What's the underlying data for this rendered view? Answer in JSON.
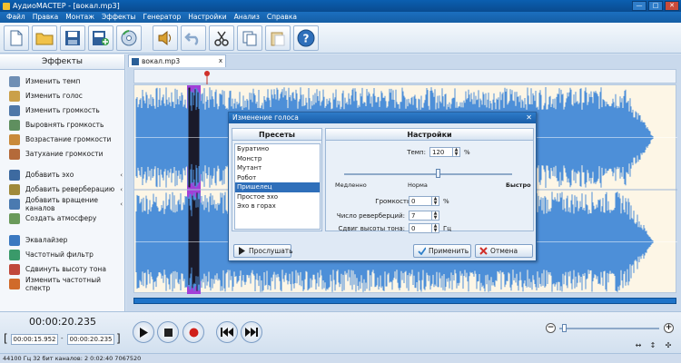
{
  "window": {
    "title": "АудиоМАСТЕР - [вокал.mp3]",
    "controls": [
      "—",
      "□",
      "✕"
    ]
  },
  "menu": [
    "Файл",
    "Правка",
    "Монтаж",
    "Эффекты",
    "Генератор",
    "Настройки",
    "Анализ",
    "Справка"
  ],
  "toolbar": {
    "buttons": [
      "new-file",
      "open-folder",
      "save",
      "add-file",
      "record-cd",
      "speaker",
      "undo",
      "cut",
      "copy",
      "paste",
      "help"
    ]
  },
  "effects": {
    "header": "Эффекты",
    "items": [
      {
        "label": "Изменить темп",
        "icon": "clock-icon",
        "color": "#6f8fb5"
      },
      {
        "label": "Изменить голос",
        "icon": "person-icon",
        "color": "#caa04a"
      },
      {
        "label": "Изменить громкость",
        "icon": "people-icon",
        "color": "#4f78a8"
      },
      {
        "label": "Выровнять громкость",
        "icon": "people-icon",
        "color": "#5f8f5f"
      },
      {
        "label": "Возрастание громкости",
        "icon": "person-up-icon",
        "color": "#c98a3a"
      },
      {
        "label": "Затухание громкости",
        "icon": "person-down-icon",
        "color": "#b46a3a"
      },
      {
        "label": "Добавить эхо",
        "icon": "echo-icon",
        "color": "#3d6aa0",
        "arrow": true
      },
      {
        "label": "Добавить реверберацию",
        "icon": "reverb-icon",
        "color": "#a08a3a",
        "arrow": true
      },
      {
        "label": "Добавить вращение каналов",
        "icon": "rotate-icon",
        "color": "#4a7ab0",
        "arrow": true
      },
      {
        "label": "Создать атмосферу",
        "icon": "atmosphere-icon",
        "color": "#6a9a5a"
      },
      {
        "label": "Эквалайзер",
        "icon": "equalizer-icon",
        "color": "#3a78c0"
      },
      {
        "label": "Частотный фильтр",
        "icon": "filter-icon",
        "color": "#3a9a6a"
      },
      {
        "label": "Сдвинуть высоту тона",
        "icon": "pitch-icon",
        "color": "#c0483a"
      },
      {
        "label": "Изменить частотный спектр",
        "icon": "spectrum-icon",
        "color": "#d06a2a"
      }
    ]
  },
  "file_tab": {
    "label": "вокал.mp3",
    "close": "x"
  },
  "dialog": {
    "title": "Изменение голоса",
    "close": "✕",
    "presets_header": "Пресеты",
    "settings_header": "Настройки",
    "presets": [
      "Буратино",
      "Монстр",
      "Мутант",
      "Робот",
      "Пришелец",
      "Простое эхо",
      "Эхо в горах"
    ],
    "selected_preset": "Пришелец",
    "tempo": {
      "label": "Темп:",
      "value": "120",
      "unit": "%"
    },
    "slider": {
      "left": "Медленно",
      "middle": "Норма",
      "right": "Быстро"
    },
    "echo_volume": {
      "label": "Громкость эха:",
      "value": "0",
      "unit": "%"
    },
    "reverb_count": {
      "label": "Число реверберций:",
      "value": "7"
    },
    "pitch_shift": {
      "label": "Сдвиг высоты тона:",
      "value": "0",
      "unit": "Гц"
    },
    "listen_button": "Прослушать",
    "apply_button": "Применить",
    "cancel_button": "Отмена"
  },
  "transport": {
    "current_time": "00:00:20.235",
    "selection_start": "00:00:15.952",
    "selection_end": "00:00:20.235"
  },
  "status": "44100 Гц  32 бит  каналов: 2   0:02:40 7067520",
  "colors": {
    "wave": "#4d8fd8",
    "wave_bg": "#fdf6e6",
    "selection": "#a23fd8",
    "accent": "#1b6fbf"
  }
}
